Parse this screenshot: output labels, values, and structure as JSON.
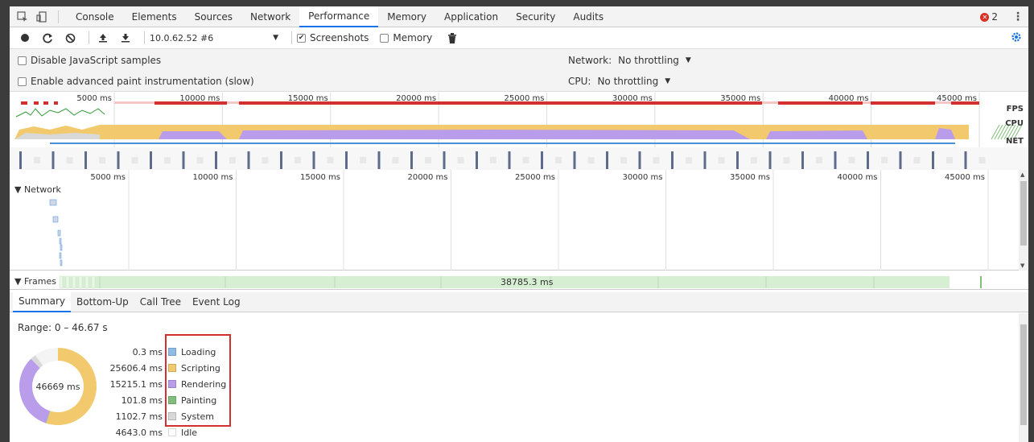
{
  "tabs": [
    "Console",
    "Elements",
    "Sources",
    "Network",
    "Performance",
    "Memory",
    "Application",
    "Security",
    "Audits"
  ],
  "active_tab": "Performance",
  "error_count": "2",
  "toolbar": {
    "target": "10.0.62.52 #6",
    "screenshots_label": "Screenshots",
    "screenshots_checked": true,
    "memory_label": "Memory",
    "memory_checked": false
  },
  "settings": {
    "disable_js_samples": "Disable JavaScript samples",
    "advanced_paint": "Enable advanced paint instrumentation (slow)",
    "network_label": "Network:",
    "network_value": "No throttling",
    "cpu_label": "CPU:",
    "cpu_value": "No throttling"
  },
  "overview": {
    "ticks": [
      "5000 ms",
      "10000 ms",
      "15000 ms",
      "20000 ms",
      "25000 ms",
      "30000 ms",
      "35000 ms",
      "40000 ms",
      "45000 ms"
    ],
    "fps_label": "FPS",
    "cpu_label": "CPU",
    "net_label": "NET"
  },
  "timeline": {
    "ticks": [
      "5000 ms",
      "10000 ms",
      "15000 ms",
      "20000 ms",
      "25000 ms",
      "30000 ms",
      "35000 ms",
      "40000 ms",
      "45000 ms"
    ],
    "network_label": "▼ Network"
  },
  "frames": {
    "label": "▼ Frames",
    "duration": "38785.3 ms"
  },
  "bottom_tabs": [
    "Summary",
    "Bottom-Up",
    "Call Tree",
    "Event Log"
  ],
  "summary": {
    "range": "Range: 0 – 46.67 s",
    "total": "46669 ms",
    "items": [
      {
        "value": "0.3 ms",
        "label": "Loading",
        "ms": 0.3,
        "color": "#8fbce6"
      },
      {
        "value": "25606.4 ms",
        "label": "Scripting",
        "ms": 25606.4,
        "color": "#f2c96d"
      },
      {
        "value": "15215.1 ms",
        "label": "Rendering",
        "ms": 15215.1,
        "color": "#b99cea"
      },
      {
        "value": "101.8 ms",
        "label": "Painting",
        "ms": 101.8,
        "color": "#7fbf7b"
      },
      {
        "value": "1102.7 ms",
        "label": "System",
        "ms": 1102.7,
        "color": "#d9d9d9"
      },
      {
        "value": "4643.0 ms",
        "label": "Idle",
        "ms": 4643.0,
        "color": "#ffffff"
      }
    ]
  },
  "colors": {
    "accent": "#1a73e8",
    "highlight_box": "#d32f2f",
    "fps_bar": "#d32f2f",
    "cpu_scripting": "#f2c96d",
    "cpu_rendering": "#b99cea",
    "frames_green": "#d6efd2"
  }
}
